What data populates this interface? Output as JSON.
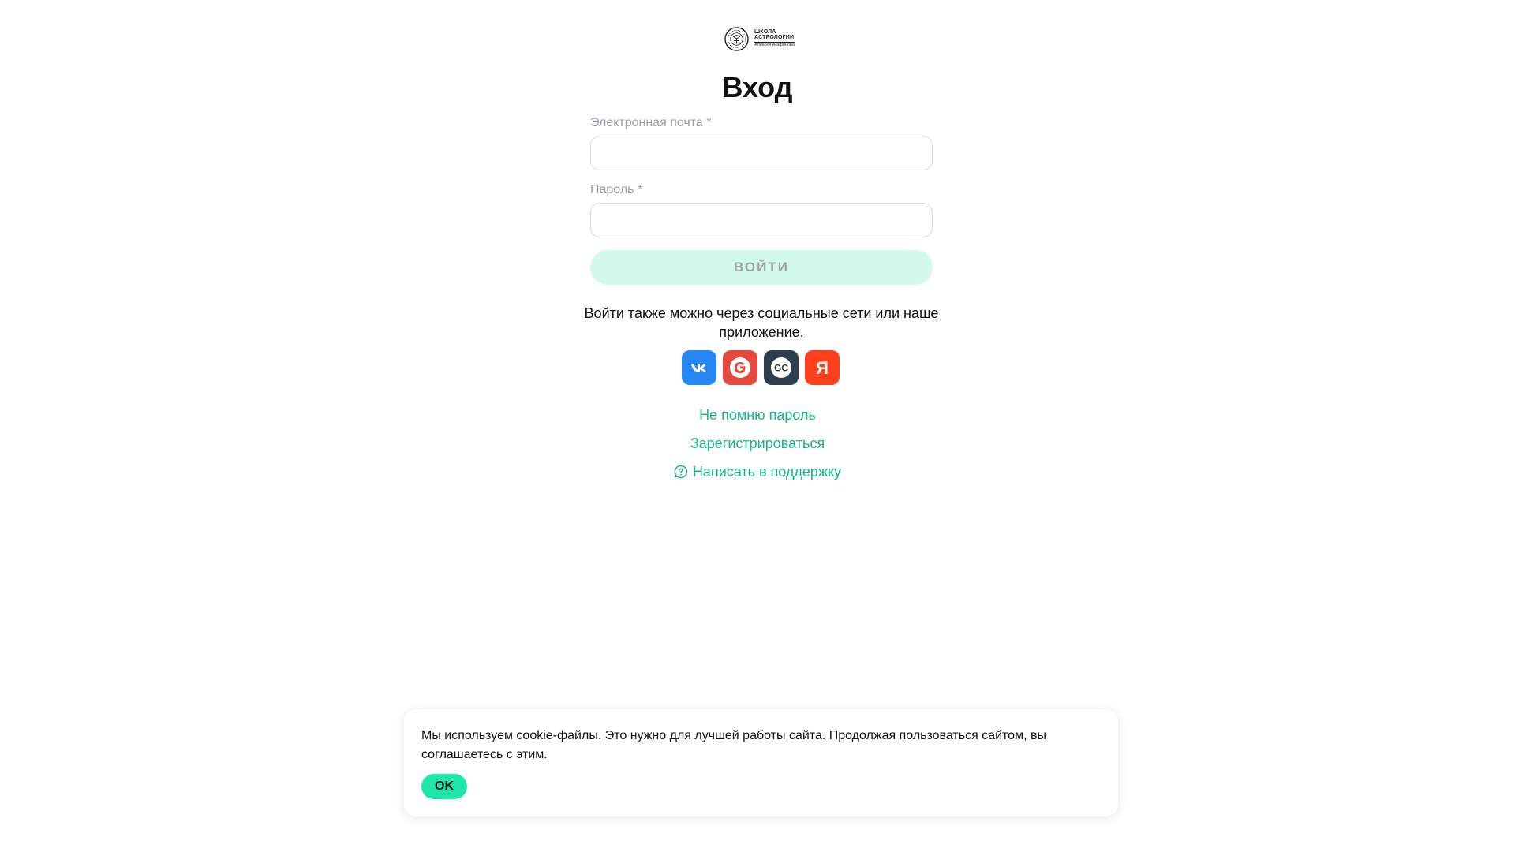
{
  "logo": {
    "line1": "ШКОЛА",
    "line2": "АСТРОЛОГИИ",
    "line3": "Алексея Агафонова"
  },
  "title": "Вход",
  "form": {
    "email_label": "Электронная почта *",
    "email_value": "",
    "password_label": "Пароль *",
    "password_value": "",
    "submit_label": "ВОЙТИ"
  },
  "social": {
    "text": "Войти также можно через социальные сети или наше приложение.",
    "items": [
      {
        "name": "vk",
        "icon": "vk-icon",
        "color": "#2787f5"
      },
      {
        "name": "google",
        "icon": "google-icon",
        "color": "#e5493d"
      },
      {
        "name": "gc",
        "icon": "gc-app-icon",
        "color": "#2e3e4e"
      },
      {
        "name": "yandex",
        "icon": "yandex-icon",
        "color": "#fc3f1d"
      }
    ]
  },
  "links": {
    "forgot_password": "Не помню пароль",
    "register": "Зарегистрироваться",
    "support": "Написать в поддержку"
  },
  "cookie": {
    "text": "Мы используем cookie-файлы. Это нужно для лучшей работы сайта. Продолжая пользоваться сайтом, вы соглашаетесь с этим.",
    "ok_label": "OK"
  },
  "colors": {
    "accent": "#16b48a",
    "button_bg": "#d3f9ec",
    "ok_bg": "#1ee6a8"
  }
}
